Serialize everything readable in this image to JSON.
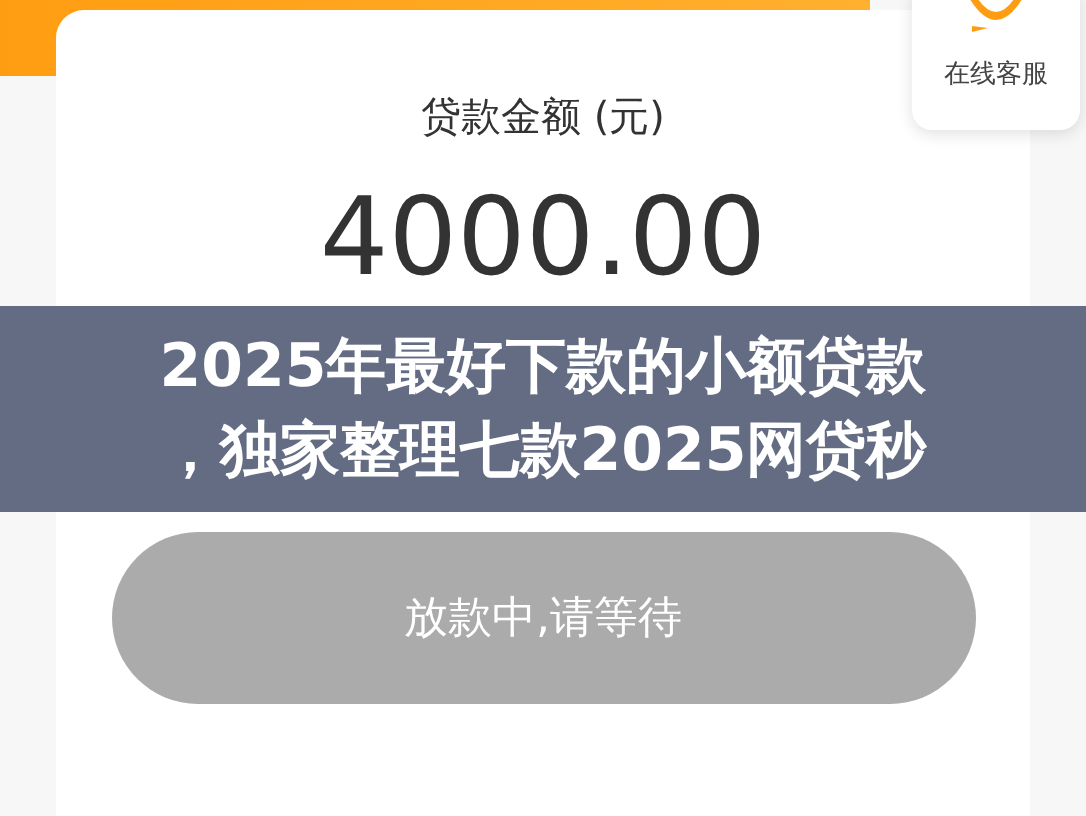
{
  "loan_card": {
    "label": "贷款金额 (元)",
    "amount": "4000.00"
  },
  "customer_service": {
    "label": "在线客服"
  },
  "caption_banner": {
    "lines": [
      "2025年最好下款的小额贷款",
      "，独家整理七款2025网贷秒"
    ]
  },
  "status_button": {
    "label": "放款中,请等待",
    "disabled": true
  }
}
